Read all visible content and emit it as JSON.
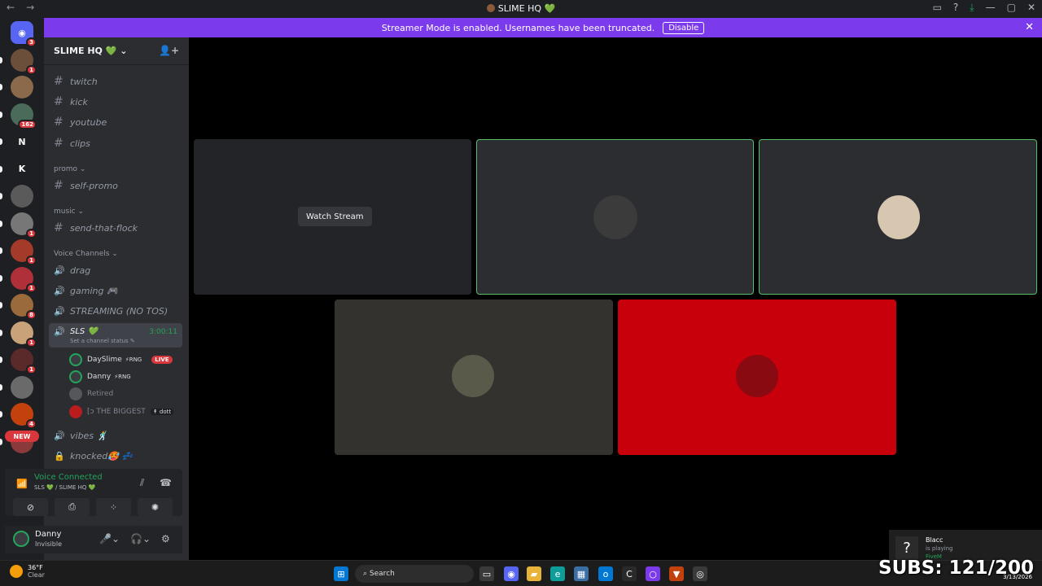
{
  "titlebar": {
    "title": "SLIME HQ 💚",
    "back": "←",
    "forward": "→",
    "icons": [
      "▭",
      "?",
      "⤓",
      "—",
      "▢",
      "✕"
    ]
  },
  "banner": {
    "text": "Streamer Mode is enabled. Usernames have been truncated.",
    "button": "Disable",
    "close": "✕"
  },
  "servers": [
    {
      "glyph": "◉",
      "color": "#5865f2",
      "badge": "3"
    },
    {
      "glyph": "",
      "color": "#6b4f3a",
      "badge": "1"
    },
    {
      "glyph": "",
      "color": "#8a6a4a",
      "badge": ""
    },
    {
      "glyph": "",
      "color": "#4a6a5a",
      "badge": "162"
    },
    {
      "glyph": "N",
      "color": "#1e1f22",
      "badge": ""
    },
    {
      "glyph": "K",
      "color": "#1e1f22",
      "badge": ""
    },
    {
      "glyph": "",
      "color": "#5a5a5a",
      "badge": ""
    },
    {
      "glyph": "",
      "color": "#777777",
      "badge": "1"
    },
    {
      "glyph": "",
      "color": "#a33a2a",
      "badge": "1"
    },
    {
      "glyph": "",
      "color": "#b0303a",
      "badge": "1"
    },
    {
      "glyph": "",
      "color": "#9a6a3a",
      "badge": "8"
    },
    {
      "glyph": "",
      "color": "#c9a27a",
      "badge": "1"
    },
    {
      "glyph": "",
      "color": "#5a2a2a",
      "badge": "1"
    },
    {
      "glyph": "",
      "color": "#6a6a6a",
      "badge": ""
    },
    {
      "glyph": "",
      "color": "#c2410c",
      "badge": "4"
    },
    {
      "glyph": "",
      "color": "#8a3a3a",
      "badge": ""
    }
  ],
  "new_tag": "NEW",
  "guild": {
    "name": "SLIME HQ 💚",
    "chevron": "⌄"
  },
  "text_channels": [
    {
      "name": "twitch"
    },
    {
      "name": "kick"
    },
    {
      "name": "youtube"
    },
    {
      "name": "clips"
    }
  ],
  "categories": {
    "promo": "promo ⌄",
    "music": "music ⌄",
    "voice": "Voice Channels ⌄"
  },
  "promo_channels": [
    {
      "name": "self-promo"
    }
  ],
  "music_channels": [
    {
      "name": "send-that-flock"
    }
  ],
  "voice_channels_top": [
    {
      "name": "drag"
    },
    {
      "name": "gaming 🎮"
    },
    {
      "name": "STREAMING (NO TOS)"
    }
  ],
  "active_voice": {
    "name": "SLS 💚",
    "time": "3:00:11",
    "status": "Set a channel status ✎"
  },
  "members": [
    {
      "name": "DaySlime",
      "tag": "⚡RNG",
      "live": "LIVE"
    },
    {
      "name": "Danny",
      "tag": "⚡RNG",
      "live": ""
    },
    {
      "name": "Retired",
      "tag": "",
      "live": ""
    },
    {
      "name": "[ↄ THE BIGGEST",
      "tag": "↟ dott",
      "live": ""
    }
  ],
  "voice_channels_bottom": [
    {
      "name": "vibes 🕺",
      "icon": "🔊"
    },
    {
      "name": "knocked🥵 💤",
      "icon": "🔒"
    }
  ],
  "voice_panel": {
    "title": "Voice Connected",
    "sub": "SLS 💚 / SLIME HQ 💚"
  },
  "voice_buttons": [
    "⊘",
    "⎙",
    "⁘",
    "✺"
  ],
  "user": {
    "name": "Danny",
    "status": "Invisible"
  },
  "stage": {
    "watch_label": "Watch Stream"
  },
  "overlay": {
    "glyph": "?",
    "name": "Blacc",
    "playing": "is playing",
    "game": "FiveM"
  },
  "subs": "SUBS: 121/200",
  "taskbar": {
    "temp": "36°F",
    "condition": "Clear",
    "search": "Search",
    "date": "3/13/2026"
  }
}
